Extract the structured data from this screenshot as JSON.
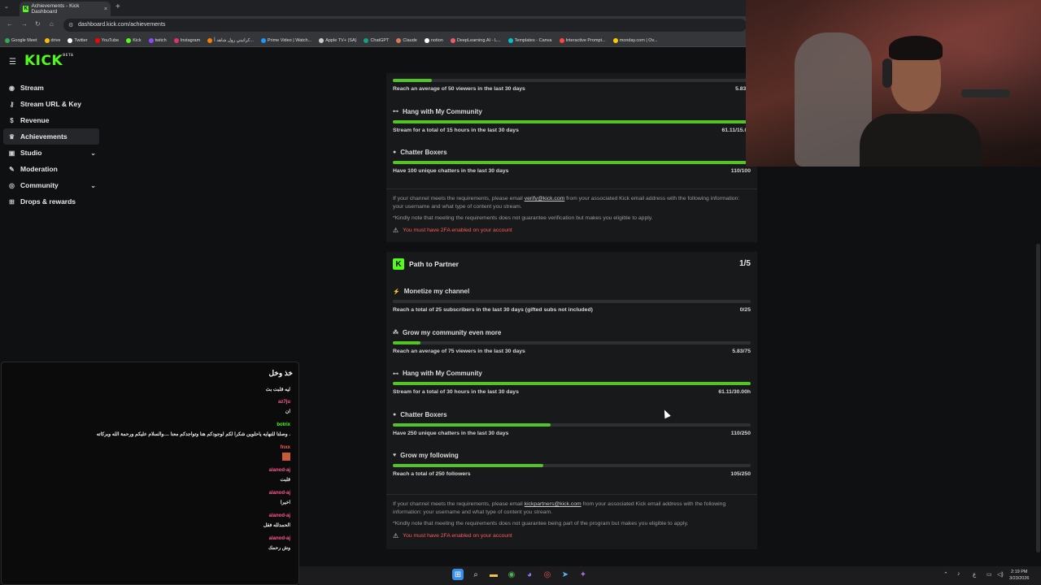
{
  "browser": {
    "tab_title": "Achievements - Kick Dashboard",
    "tab_close": "×",
    "new_tab": "+",
    "url": "dashboard.kick.com/achievements",
    "bookmarks": [
      {
        "label": "Google Meet",
        "color": "#34a853"
      },
      {
        "label": "drive",
        "color": "#fbbc04"
      },
      {
        "label": "Twitter",
        "color": "#ffffff"
      },
      {
        "label": "YouTube",
        "color": "#ff0000"
      },
      {
        "label": "Kick",
        "color": "#53fc18"
      },
      {
        "label": "twitch",
        "color": "#9146ff"
      },
      {
        "label": "Instagram",
        "color": "#e1306c"
      },
      {
        "label": "كراتيني رول شاهد أ...",
        "color": "#ff7a00"
      },
      {
        "label": "Prime Video | Watch...",
        "color": "#1a98ff"
      },
      {
        "label": "Apple TV+ (SA)",
        "color": "#cccccc"
      },
      {
        "label": "ChatGPT",
        "color": "#10a37f"
      },
      {
        "label": "Claude",
        "color": "#d97757"
      },
      {
        "label": "notion",
        "color": "#ffffff"
      },
      {
        "label": "DeepLearning.AI - L...",
        "color": "#f45b69"
      },
      {
        "label": "Templates - Canva",
        "color": "#00c4cc"
      },
      {
        "label": "Interactive Prompt...",
        "color": "#ff4444"
      },
      {
        "label": "monday.com | Ov...",
        "color": "#ffcb00"
      }
    ]
  },
  "app": {
    "logo": "KICK",
    "logo_sup": "BETA",
    "sidebar": [
      {
        "label": "Stream",
        "icon": "broadcast-icon",
        "glyph": "((•))",
        "active": false,
        "chevron": false
      },
      {
        "label": "Stream URL & Key",
        "icon": "key-icon",
        "glyph": "⚷",
        "active": false,
        "chevron": false
      },
      {
        "label": "Revenue",
        "icon": "dollar-icon",
        "glyph": "$",
        "active": false,
        "chevron": false
      },
      {
        "label": "Achievements",
        "icon": "trophy-icon",
        "glyph": "♛",
        "active": true,
        "chevron": false
      },
      {
        "label": "Studio",
        "icon": "camera-icon",
        "glyph": "▣",
        "active": false,
        "chevron": true
      },
      {
        "label": "Moderation",
        "icon": "wrench-icon",
        "glyph": "✎",
        "active": false,
        "chevron": false
      },
      {
        "label": "Community",
        "icon": "globe-icon",
        "glyph": "◎",
        "active": false,
        "chevron": true
      },
      {
        "label": "Drops & rewards",
        "icon": "gift-icon",
        "glyph": "⊞",
        "active": false,
        "chevron": false
      }
    ]
  },
  "verification": {
    "items": [
      {
        "title": "",
        "desc": "Reach an average of 50 viewers in the last 30 days",
        "value": "5.83/5",
        "progress": 0.11
      },
      {
        "title": "Hang with My Community",
        "desc": "Stream for a total of 15 hours in the last 30 days",
        "value": "61.11/15.00",
        "progress": 1.0
      },
      {
        "title": "Chatter Boxers",
        "desc": "Have 100 unique chatters in the last 30 days",
        "value": "110/100",
        "progress": 1.0
      }
    ],
    "note_pre": "If your channel meets the requirements, please email ",
    "note_email": "verify@kick.com",
    "note_post": " from your associated Kick email address with the following information: your username and what type of content you stream.",
    "note2": "*Kindly note that meeting the requirements does not guarantee verification but makes you eligible to apply.",
    "warning": "You must have 2FA enabled on your account"
  },
  "partner": {
    "title": "Path to Partner",
    "count": "1/5",
    "items": [
      {
        "title": "Monetize my channel",
        "icon": "lightning-icon",
        "glyph": "⚡",
        "desc": "Reach a total of 25 subscribers in the last 30 days (gifted subs not included)",
        "value": "0/25",
        "progress": 0.0
      },
      {
        "title": "Grow my community even more",
        "icon": "users-icon",
        "glyph": "⁂",
        "desc": "Reach an average of 75 viewers in the last 30 days",
        "value": "5.83/75",
        "progress": 0.078
      },
      {
        "title": "Hang with My Community",
        "icon": "dumbbell-icon",
        "glyph": "⊷",
        "desc": "Stream for a total of 30 hours in the last 30 days",
        "value": "61.11/30.00h",
        "progress": 1.0
      },
      {
        "title": "Chatter Boxers",
        "icon": "chat-icon",
        "glyph": "●",
        "desc": "Have 250 unique chatters in the last 30 days",
        "value": "110/250",
        "progress": 0.44
      },
      {
        "title": "Grow my following",
        "icon": "heart-icon",
        "glyph": "♥",
        "desc": "Reach a total of 250 followers",
        "value": "105/250",
        "progress": 0.42
      }
    ],
    "note_pre": "If your channel meets the requirements, please email ",
    "note_email": "kickpartners@kick.com",
    "note_post": " from your associated Kick email address with the following information: your username and what type of content you stream.",
    "note2": "*Kindly note that meeting the requirements does not guarantee being part of the program but makes you eligible to apply.",
    "warning": "You must have 2FA enabled on your account"
  },
  "chat": {
    "title": "خذ وخل",
    "messages": [
      {
        "user": "",
        "text": "ليه قلبت بث",
        "color": "#ffffff"
      },
      {
        "user": "az7ju",
        "text": "ان",
        "color": "#ff5a8a"
      },
      {
        "user": "botrix",
        "text": "وصلنا للنهايه ياحلوين شكرا لكم لوجودكم هنا وتواجدكم معنا ....والسلام عليكم ورحمة الله وبركاته .",
        "color": "#53fc18"
      },
      {
        "user": "fnxx",
        "text": "",
        "color": "#ff5a5a"
      },
      {
        "user": "alanod-aj",
        "text": "قلبت",
        "color": "#ff5a8a"
      },
      {
        "user": "alanod-aj",
        "text": "اخيرا",
        "color": "#ff5a8a"
      },
      {
        "user": "alanod-aj",
        "text": "الحمدلله فقل",
        "color": "#ff5a8a"
      },
      {
        "user": "alanod-aj",
        "text": "وش رحمك",
        "color": "#ff5a8a"
      }
    ]
  },
  "taskbar": {
    "time": "2:19 PM",
    "date": "3/23/2026"
  }
}
